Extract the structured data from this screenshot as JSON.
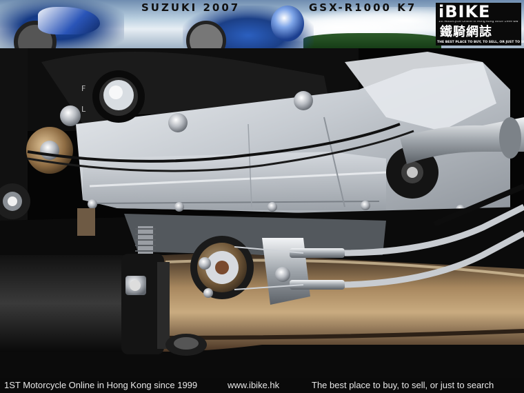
{
  "banner": {
    "title_left": "SUZUKI 2007",
    "title_right": "GSX-R1000 K7"
  },
  "logo": {
    "brand": "iBIKE",
    "cjk": "鐵騎網誌",
    "small_text": "1st Motorcycle Online in Hong Kong Since 1999 www.ibike.hk",
    "tagline": "THE BEST PLACE TO BUY, TO SELL, OR JUST TO SEARCH"
  },
  "photo": {
    "subject": "engine-close-up",
    "colors": {
      "engine_silver": "#c9cdd2",
      "cover_black": "#0d0d0d",
      "exhaust_bronze": "#8a6a48",
      "cable_black": "#111111"
    }
  },
  "footer": {
    "left": "1ST Motorcycle Online in Hong Kong since 1999",
    "url": "www.ibike.hk",
    "right": "The best place to buy, to sell, or just to search"
  }
}
